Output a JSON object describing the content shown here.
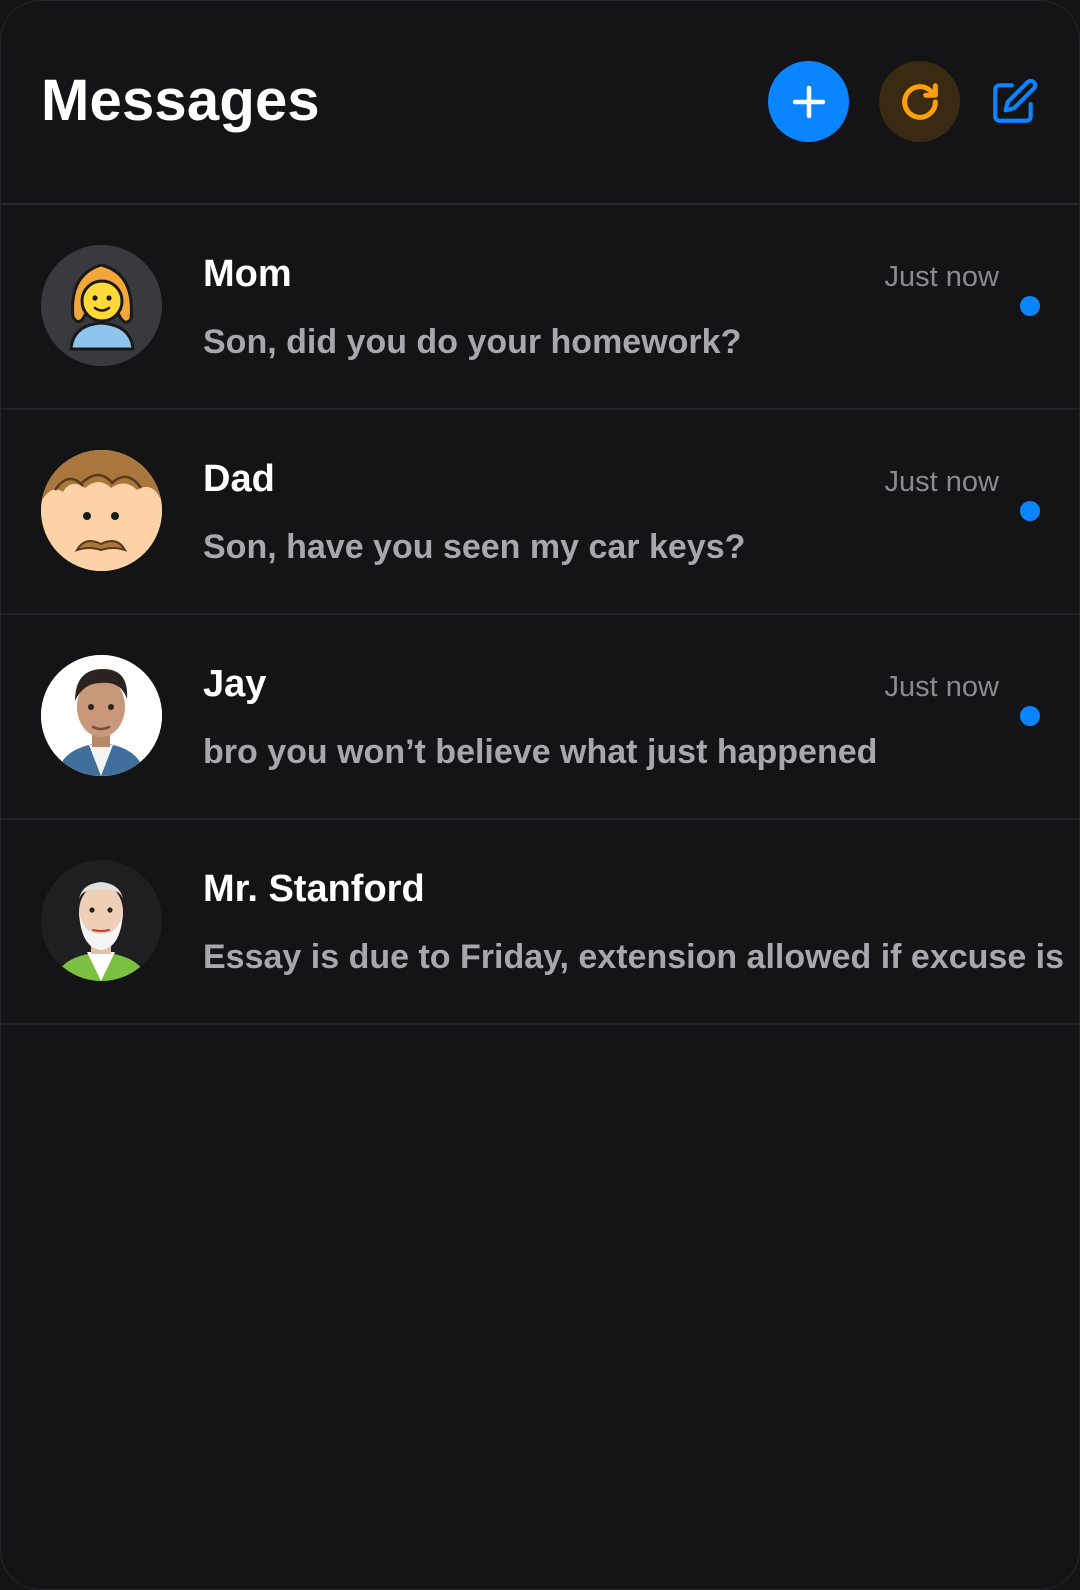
{
  "header": {
    "title": "Messages",
    "add_icon": "plus-icon",
    "refresh_icon": "refresh-icon",
    "compose_icon": "compose-icon"
  },
  "colors": {
    "background": "#141416",
    "accent_blue": "#0a84ff",
    "refresh_orange": "#ff9f0a",
    "refresh_bg": "#3a2a12",
    "preview_text": "#a7a7ac",
    "time_text": "#8a8a8f"
  },
  "conversations": [
    {
      "name": "Mom",
      "preview": "Son, did you do your homework?",
      "time": "Just now",
      "unread": true,
      "avatar": "woman-emoji-avatar"
    },
    {
      "name": "Dad",
      "preview": "Son, have you seen my car keys?",
      "time": "Just now",
      "unread": true,
      "avatar": "mustache-man-avatar"
    },
    {
      "name": "Jay",
      "preview": "bro you won’t believe what just happened",
      "time": "Just now",
      "unread": true,
      "avatar": "young-man-avatar"
    },
    {
      "name": "Mr. Stanford",
      "preview": "Essay is due to Friday, extension allowed if excuse is",
      "time": "",
      "unread": false,
      "avatar": "old-man-avatar"
    }
  ]
}
